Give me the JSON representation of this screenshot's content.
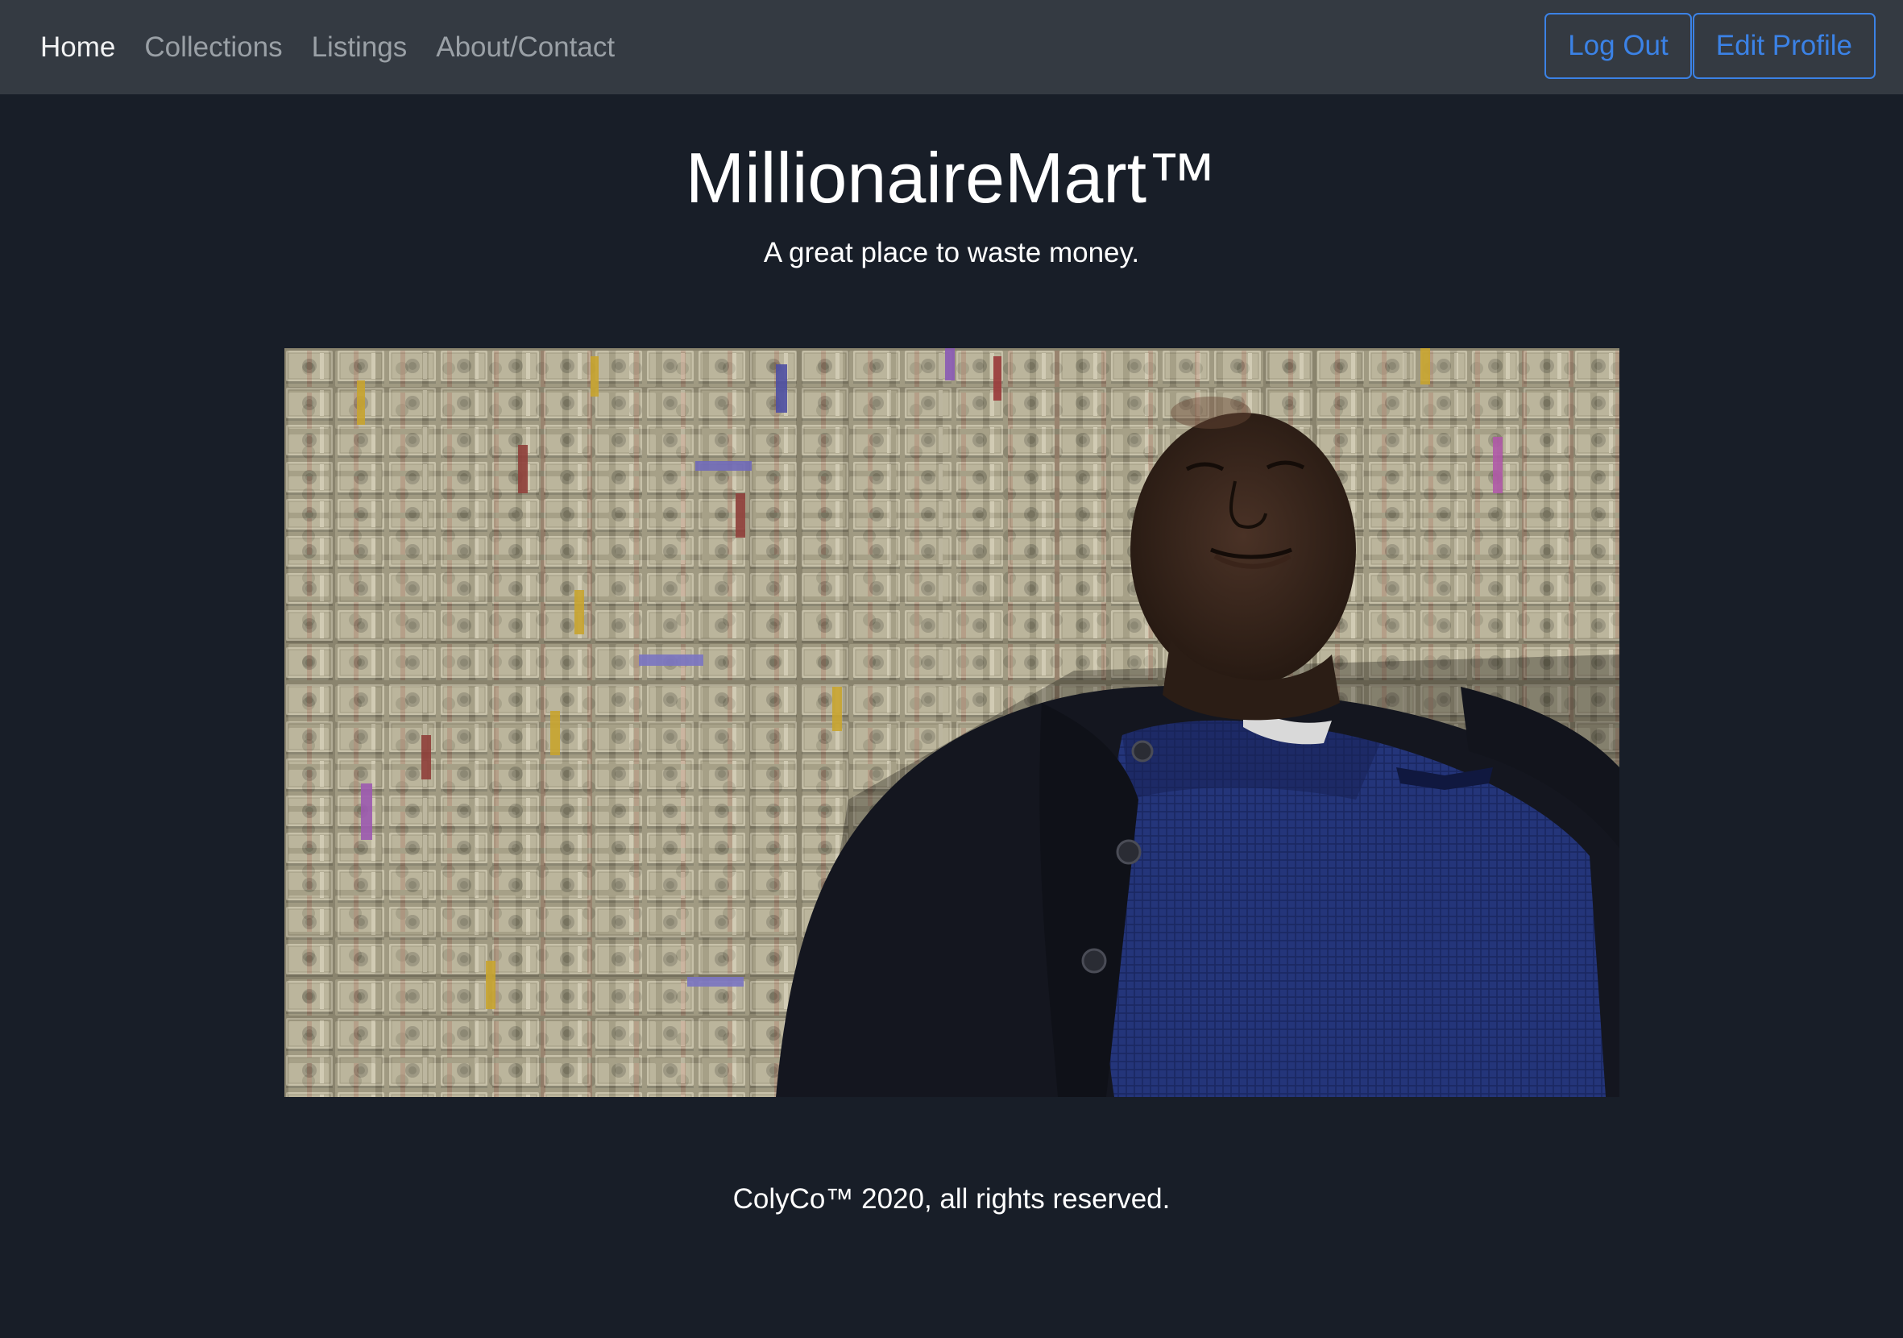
{
  "app": {
    "brand_title": "MillionaireMart™",
    "tagline": "A great place to waste money."
  },
  "nav": {
    "items": [
      {
        "label": "Home",
        "active": true
      },
      {
        "label": "Collections",
        "active": false
      },
      {
        "label": "Listings",
        "active": false
      },
      {
        "label": "About/Contact",
        "active": false
      }
    ],
    "logout_label": "Log Out",
    "edit_profile_label": "Edit Profile"
  },
  "hero": {
    "image_description": "man-lying-on-money-photo"
  },
  "footer": {
    "text": "ColyCo™ 2020, all rights reserved."
  },
  "colors": {
    "page_bg": "#181e28",
    "navbar_bg": "#343a42",
    "accent": "#3b82e6",
    "nav_inactive": "#9aa0a6",
    "nav_active": "#f1f2f3"
  }
}
